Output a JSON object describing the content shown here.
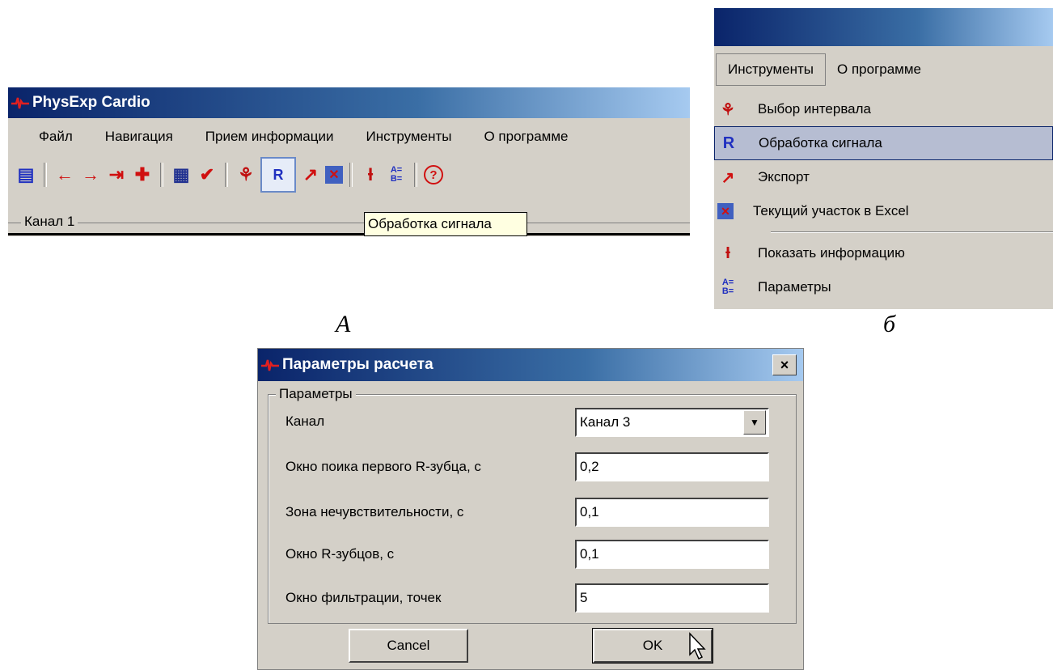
{
  "panel_a": {
    "window_title": "PhysExp Cardio",
    "menu": [
      "Файл",
      "Навигация",
      "Прием информации",
      "Инструменты",
      "О программе"
    ],
    "channel_label": "Канал 1",
    "tooltip": "Обработка сигнала",
    "caption": "А"
  },
  "panel_b": {
    "menu": [
      "Инструменты",
      "О программе"
    ],
    "items": [
      {
        "label": "Выбор интервала",
        "icon": "select-interval-icon"
      },
      {
        "label": "Обработка сигнала",
        "icon": "signal-processing-icon",
        "highlighted": true
      },
      {
        "label": "Экспорт",
        "icon": "export-arrow-icon"
      },
      {
        "label": "Текущий участок в Excel",
        "icon": "excel-icon"
      },
      {
        "label": "Показать информацию",
        "icon": "info-icon"
      },
      {
        "label": "Параметры",
        "icon": "parameters-icon"
      }
    ],
    "caption": "б"
  },
  "dialog": {
    "title": "Параметры расчета",
    "group_title": "Параметры",
    "fields": [
      {
        "label": "Канал",
        "value": "Канал 3"
      },
      {
        "label": "Окно поика первого R-зубца, с",
        "value": "0,2"
      },
      {
        "label": "Зона нечувствительности, с",
        "value": "0,1"
      },
      {
        "label": "Окно R-зубцов, с",
        "value": "0,1"
      },
      {
        "label": "Окно фильтрации, точек",
        "value": "5"
      }
    ],
    "cancel_label": "Cancel",
    "ok_label": "OK",
    "close_glyph": "×"
  }
}
